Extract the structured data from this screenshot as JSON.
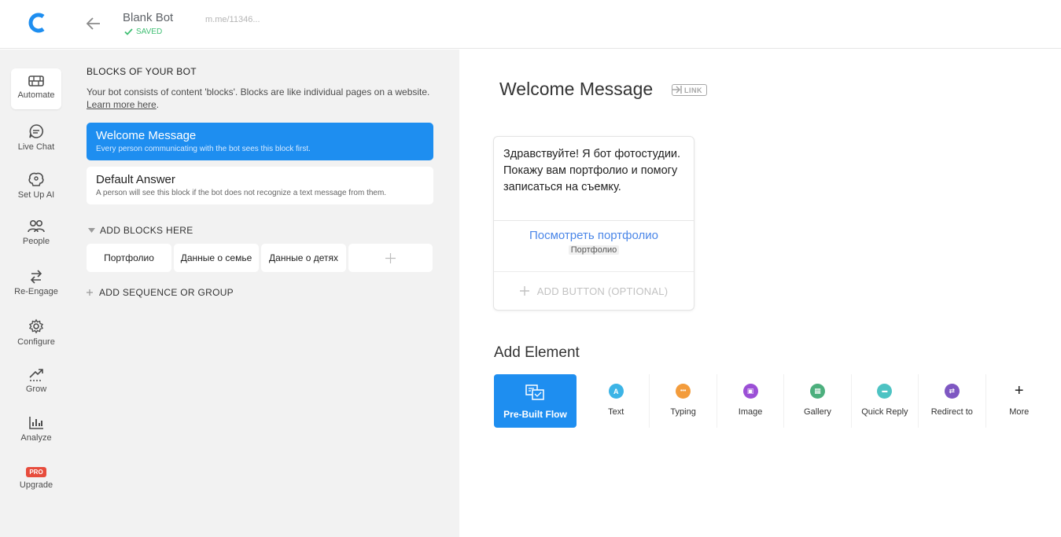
{
  "header": {
    "bot_name": "Blank Bot",
    "saved_label": "SAVED",
    "bot_link": "m.me/11346..."
  },
  "sidebar": {
    "items": [
      {
        "label": "Automate",
        "icon": "automate-icon",
        "active": true
      },
      {
        "label": "Live Chat",
        "icon": "chat-icon"
      },
      {
        "label": "Set Up AI",
        "icon": "ai-brain-icon"
      },
      {
        "label": "People",
        "icon": "people-icon"
      },
      {
        "label": "Re-Engage",
        "icon": "re-engage-icon"
      },
      {
        "label": "Configure",
        "icon": "gear-icon"
      },
      {
        "label": "Grow",
        "icon": "grow-icon"
      },
      {
        "label": "Analyze",
        "icon": "analyze-icon"
      },
      {
        "label": "Upgrade",
        "icon": "upgrade-icon",
        "badge": "PRO"
      }
    ]
  },
  "blocks": {
    "title": "BLOCKS OF YOUR BOT",
    "description": "Your bot consists of content 'blocks'. Blocks are like individual pages on a website.",
    "learn_more": "Learn more here",
    "learn_more_suffix": ".",
    "welcome": {
      "title": "Welcome Message",
      "subtitle": "Every person communicating with the bot sees this block first."
    },
    "default": {
      "title": "Default Answer",
      "subtitle": "A person will see this block if the bot does not recognize a text message from them."
    },
    "add_blocks_label": "ADD BLOCKS HERE",
    "custom_blocks": [
      "Портфолио",
      "Данные о семье",
      "Данные о детях"
    ],
    "add_sequence_label": "ADD SEQUENCE OR GROUP"
  },
  "editor": {
    "title": "Welcome Message",
    "link_badge": "LINK",
    "message_text": "Здравствуйте! Я бот фотостудии. Покажу вам портфолио и помогу записаться на съемку.",
    "button_label": "Посмотреть портфолио",
    "button_target": "Портфолио",
    "add_button_label": "ADD BUTTON (OPTIONAL)",
    "add_element_title": "Add Element",
    "prebuilt_label": "Pre-Built Flow",
    "elements": [
      {
        "label": "Text",
        "icon": "text-icon",
        "color": "#3cb4e6",
        "glyph": "A"
      },
      {
        "label": "Typing",
        "icon": "typing-icon",
        "color": "#f39c3c",
        "glyph": "•••"
      },
      {
        "label": "Image",
        "icon": "image-icon",
        "color": "#9b4fd6",
        "glyph": "▣"
      },
      {
        "label": "Gallery",
        "icon": "gallery-icon",
        "color": "#4caf7d",
        "glyph": "▦"
      },
      {
        "label": "Quick Reply",
        "icon": "quick-reply-icon",
        "color": "#4dc3c3",
        "glyph": "▬"
      },
      {
        "label": "Redirect to",
        "icon": "redirect-icon",
        "color": "#7e57c2",
        "glyph": "⇄"
      },
      {
        "label": "More",
        "icon": "plus-icon",
        "color": "",
        "glyph": "+"
      }
    ]
  }
}
